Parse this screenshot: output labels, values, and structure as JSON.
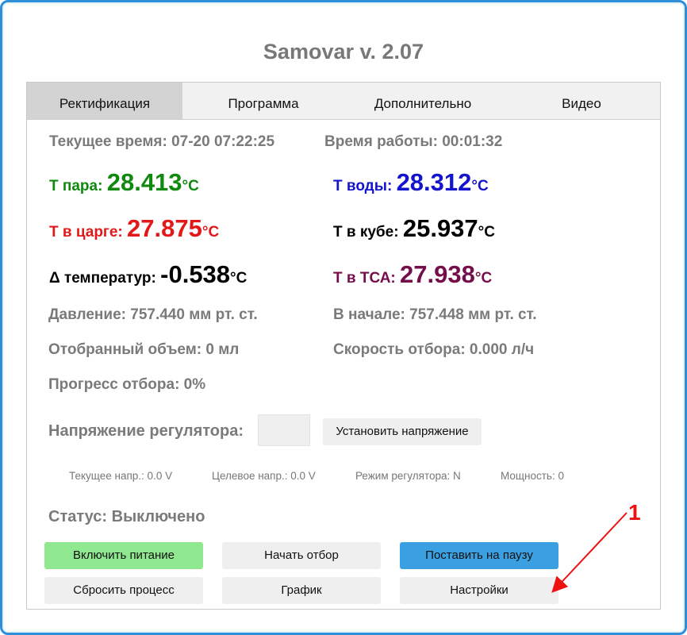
{
  "app": {
    "title": "Samovar v. 2.07"
  },
  "tabs": [
    "Ректификация",
    "Программа",
    "Дополнительно",
    "Видео"
  ],
  "status_line": {
    "current_time": "Текущее время: 07-20 07:22:25",
    "work_time": "Время работы: 00:01:32"
  },
  "temps": {
    "steam": {
      "label": "Т пара: ",
      "value": "28.413",
      "unit": "°C",
      "color": "#0f8a0f"
    },
    "water": {
      "label": "Т воды: ",
      "value": "28.312",
      "unit": "°C",
      "color": "#1414cc"
    },
    "column": {
      "label": "Т в царге: ",
      "value": "27.875",
      "unit": "°C",
      "color": "#e31818"
    },
    "cube": {
      "label": "Т в кубе: ",
      "value": "25.937",
      "unit": "°C",
      "color": "#000000"
    },
    "delta": {
      "label": "Δ температур: ",
      "value": "-0.538",
      "unit": "°C",
      "color": "#000000"
    },
    "tsa": {
      "label": "Т в ТСА: ",
      "value": "27.938",
      "unit": "°C",
      "color": "#760d4b"
    }
  },
  "info": {
    "pressure": "Давление: 757.440 мм рт. ст.",
    "pressure_start": "В начале: 757.448 мм рт. ст.",
    "volume": "Отобранный объем: 0 мл",
    "speed": "Скорость отбора: 0.000 л/ч",
    "progress": "Прогресс отбора: 0%"
  },
  "regulator": {
    "label": "Напряжение регулятора:",
    "input_value": "",
    "set_button": "Установить напряжение",
    "current_voltage": "Текущее напр.: 0.0 V",
    "target_voltage": "Целевое напр.: 0.0 V",
    "mode": "Режим регулятора: N",
    "power": "Мощность: 0"
  },
  "status": "Статус: Выключено",
  "buttons": {
    "power_on": "Включить питание",
    "start_take": "Начать отбор",
    "pause": "Поставить на паузу",
    "reset": "Сбросить процесс",
    "chart": "График",
    "settings": "Настройки"
  },
  "annotation": {
    "label": "1",
    "color": "#ee1111"
  },
  "colors": {
    "frame": "#2d8fd9",
    "power_on_bg": "#8fe88f",
    "pause_bg": "#3aa0e1"
  }
}
